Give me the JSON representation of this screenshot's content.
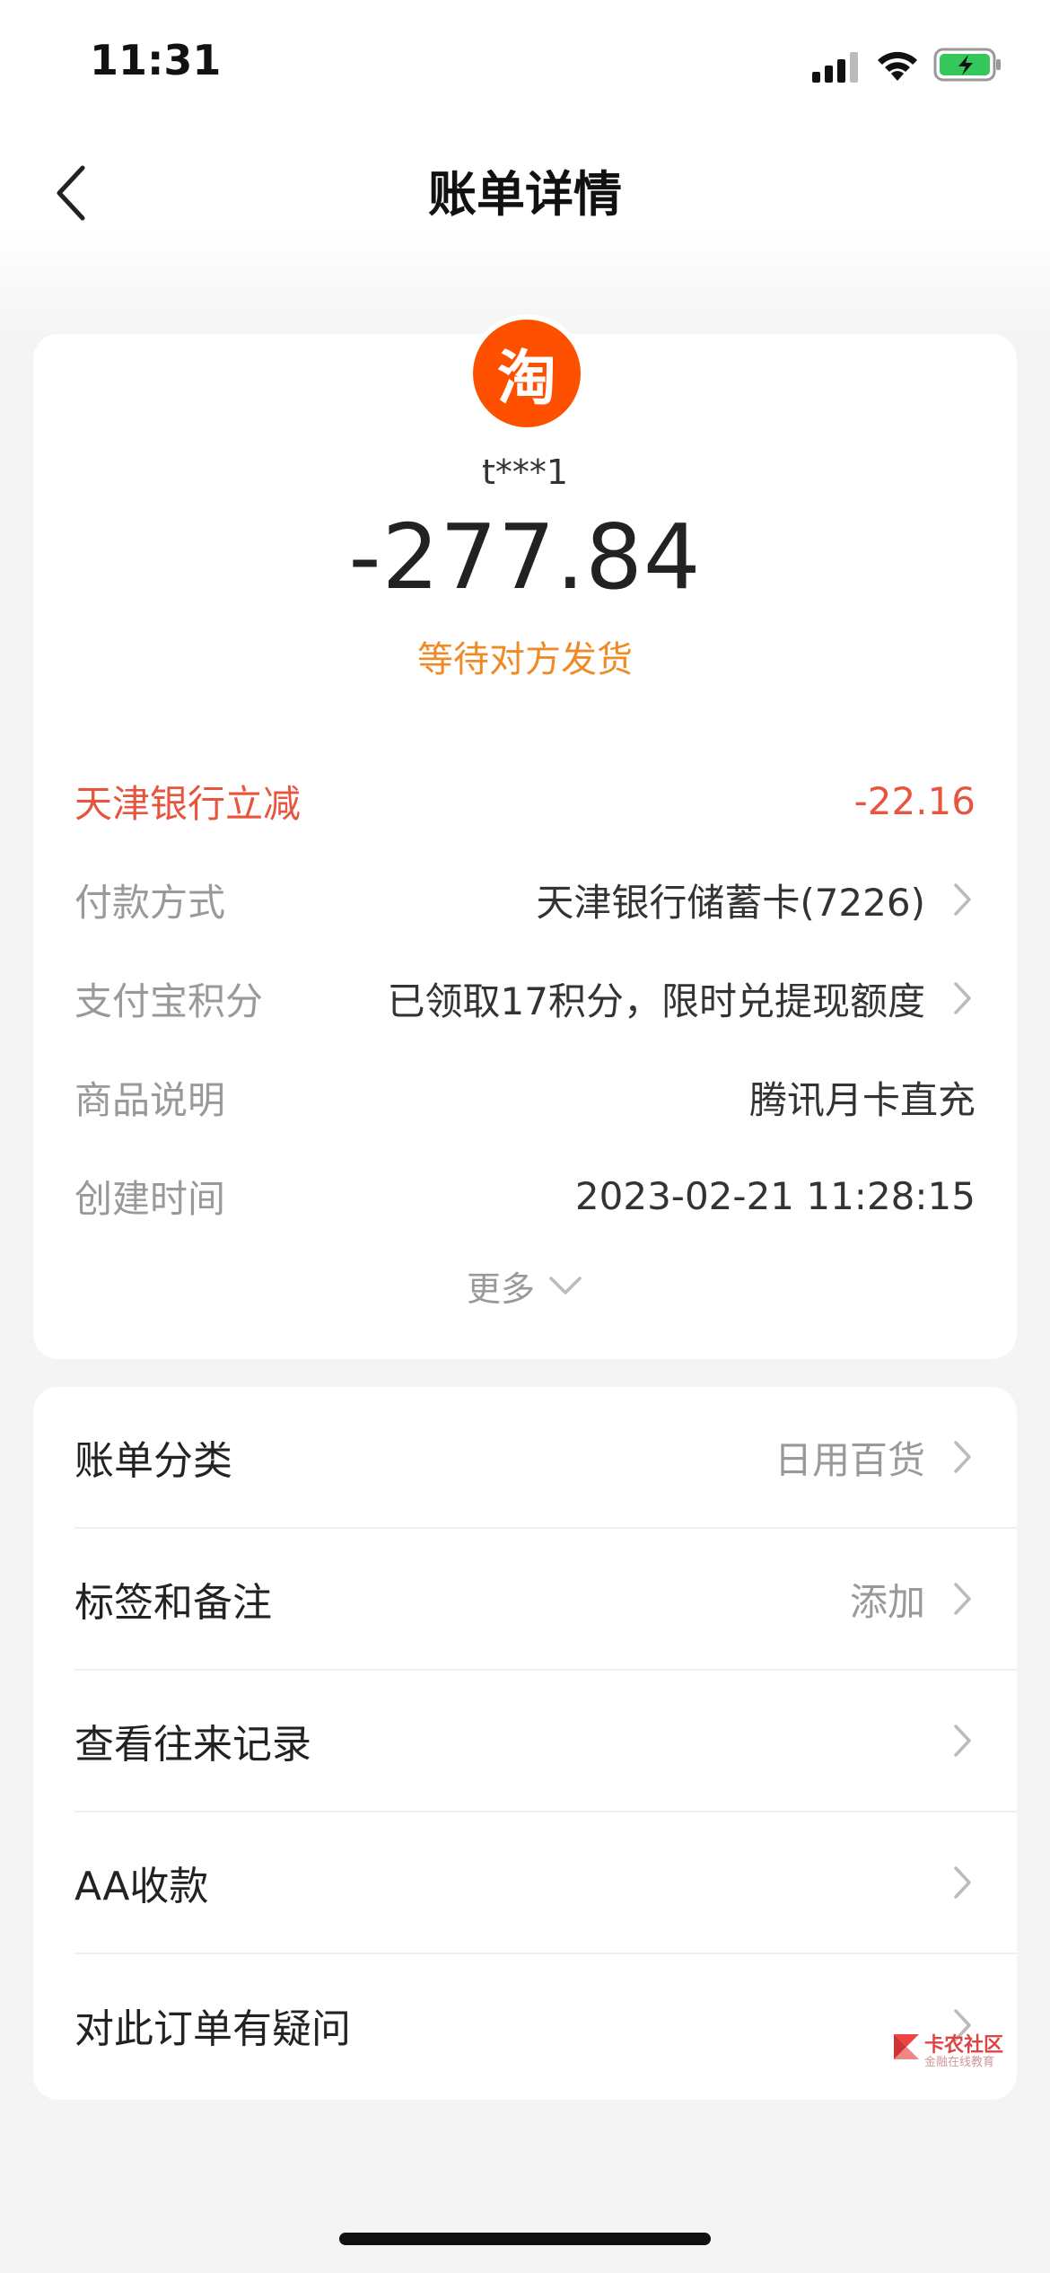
{
  "status_bar": {
    "time": "11:31",
    "icons": [
      "signal-icon",
      "wifi-icon",
      "battery-charging-icon"
    ]
  },
  "nav": {
    "title": "账单详情",
    "back_icon": "chevron-left-icon"
  },
  "summary": {
    "merchant_logo_char": "淘",
    "merchant_name": "t***1",
    "amount": "-277.84",
    "status": "等待对方发货"
  },
  "details": [
    {
      "label": "天津银行立减",
      "value": "-22.16"
    },
    {
      "label": "付款方式",
      "value": "天津银行储蓄卡(7226)"
    },
    {
      "label": "支付宝积分",
      "value": "已领取17积分，限时兑提现额度"
    },
    {
      "label": "商品说明",
      "value": "腾讯月卡直充"
    },
    {
      "label": "创建时间",
      "value": "2023-02-21 11:28:15"
    }
  ],
  "more_label": "更多",
  "menu": [
    {
      "label": "账单分类",
      "value": "日用百货"
    },
    {
      "label": "标签和备注",
      "value": "添加"
    },
    {
      "label": "查看往来记录",
      "value": ""
    },
    {
      "label": "AA收款",
      "value": ""
    },
    {
      "label": "对此订单有疑问",
      "value": ""
    }
  ],
  "watermark": {
    "text": "卡农社区",
    "sub": "金融在线教育"
  },
  "colors": {
    "accent_orange": "#f08a24",
    "discount_red": "#e8553f",
    "taobao_orange": "#ff5000",
    "background": "#f4f4f4"
  }
}
